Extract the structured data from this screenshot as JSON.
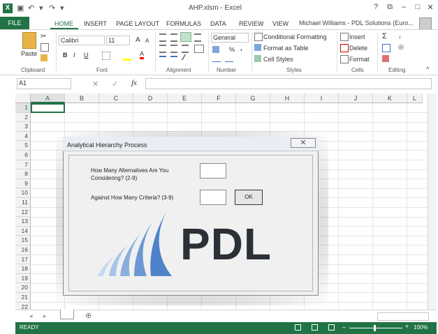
{
  "window": {
    "title": "AHP.xlsm - Excel",
    "user": "Michael Williams - PDL Solutions (Euro...",
    "help": "?",
    "restore": "⧉",
    "minimize": "–",
    "maximize": "□",
    "close": "✕"
  },
  "qat": {
    "undo": "↶",
    "redo": "↷",
    "save": "▣",
    "more": "▾"
  },
  "tabs": [
    "FILE",
    "HOME",
    "INSERT",
    "PAGE LAYOUT",
    "FORMULAS",
    "DATA",
    "REVIEW",
    "VIEW"
  ],
  "ribbon": {
    "clipboard": {
      "label": "Clipboard",
      "paste": "Paste"
    },
    "font": {
      "label": "Font",
      "name": "Calibri",
      "size": "11",
      "bold": "B",
      "italic": "I",
      "underline": "U",
      "grow": "A",
      "shrink": "A",
      "fill_a": "A"
    },
    "alignment": {
      "label": "Alignment"
    },
    "number": {
      "label": "Number",
      "format": "General",
      "percent": "%",
      "comma": ","
    },
    "styles": {
      "label": "Styles",
      "conditional": "Conditional Formatting",
      "table": "Format as Table",
      "cell_styles": "Cell Styles"
    },
    "cells": {
      "label": "Cells",
      "insert": "Insert",
      "delete": "Delete",
      "format": "Format"
    },
    "editing": {
      "label": "Editing",
      "sum": "Σ",
      "sort": "↓",
      "find": "◎"
    }
  },
  "formula_bar": {
    "name_box": "A1",
    "fx": "fx",
    "cancel": "✕",
    "enter": "✓",
    "value": ""
  },
  "columns": [
    "A",
    "B",
    "C",
    "D",
    "E",
    "F",
    "G",
    "H",
    "I",
    "J",
    "K",
    "L"
  ],
  "rows": [
    "1",
    "2",
    "3",
    "4",
    "5",
    "6",
    "7",
    "8",
    "9",
    "10",
    "11",
    "12",
    "13",
    "14",
    "15",
    "16",
    "17",
    "18",
    "19",
    "20",
    "21",
    "22"
  ],
  "dialog": {
    "title": "Analytical Hierarchy Process",
    "q1_line1": "How Many Alternatives Are You",
    "q1_line2": "Considering? (2-9)",
    "q2": "Against How Many Criteria? (3-9)",
    "alternatives_value": "",
    "criteria_value": "",
    "ok_label": "OK",
    "close_glyph": "✕",
    "logo_text": "PDL",
    "logo_colors": {
      "blue": "#4f83c9",
      "dark": "#2b2f36"
    }
  },
  "status": {
    "text": "READY",
    "zoom": "100%",
    "zoom_minus": "–",
    "zoom_plus": "+"
  },
  "sheet": {
    "add": "⊕",
    "prev": "◂",
    "next": "▸"
  },
  "colors": {
    "accent": "#217346"
  }
}
